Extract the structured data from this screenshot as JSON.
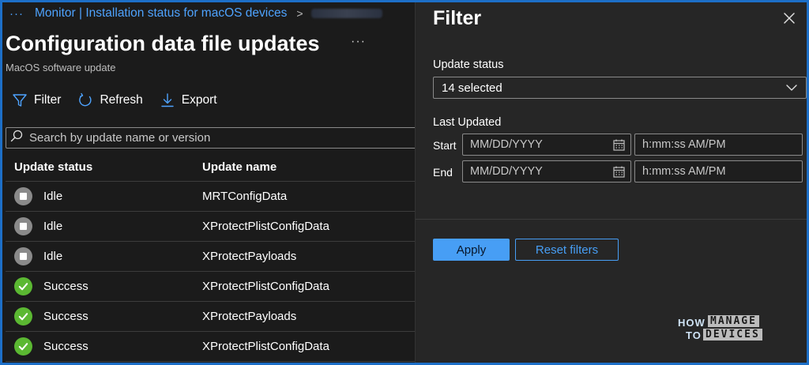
{
  "breadcrumb": {
    "more": "···",
    "link": "Monitor | Installation status for macOS devices",
    "separator": ">"
  },
  "page": {
    "title": "Configuration data file updates",
    "more": "···",
    "subtitle": "MacOS software update"
  },
  "toolbar": {
    "filter_label": "Filter",
    "refresh_label": "Refresh",
    "export_label": "Export"
  },
  "search": {
    "placeholder": "Search by update name or version",
    "value": ""
  },
  "grid": {
    "columns": [
      "Update status",
      "Update name"
    ],
    "rows": [
      {
        "status": "Idle",
        "status_icon": "idle-icon",
        "name": "MRTConfigData"
      },
      {
        "status": "Idle",
        "status_icon": "idle-icon",
        "name": "XProtectPlistConfigData"
      },
      {
        "status": "Idle",
        "status_icon": "idle-icon",
        "name": "XProtectPayloads"
      },
      {
        "status": "Success",
        "status_icon": "checkmark-icon",
        "name": "XProtectPlistConfigData"
      },
      {
        "status": "Success",
        "status_icon": "checkmark-icon",
        "name": "XProtectPayloads"
      },
      {
        "status": "Success",
        "status_icon": "checkmark-icon",
        "name": "XProtectPlistConfigData"
      }
    ]
  },
  "filter_pane": {
    "title": "Filter",
    "update_status_label": "Update status",
    "update_status_value": "14 selected",
    "last_updated_label": "Last Updated",
    "start_label": "Start",
    "end_label": "End",
    "date_placeholder": "MM/DD/YYYY",
    "time_placeholder": "h:mm:ss AM/PM",
    "apply_label": "Apply",
    "reset_label": "Reset filters"
  },
  "watermark": {
    "how": "HOW",
    "to": "TO",
    "manage": "MANAGE",
    "devices": "DEVICES"
  },
  "colors": {
    "accent": "#479ef5",
    "link": "#4ea3ff",
    "success": "#5bb832",
    "idle": "#8a8a8a",
    "frame": "#1d6fc7"
  }
}
